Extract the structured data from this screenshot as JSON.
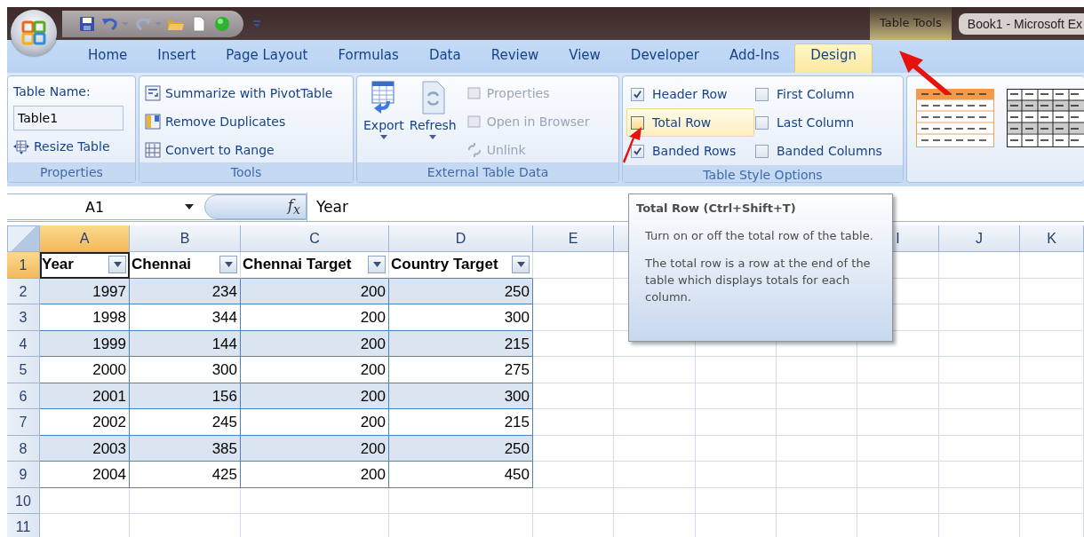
{
  "titlebar": {
    "context_label": "Table Tools",
    "window_title": "Book1  -  Microsoft Ex"
  },
  "tabs": [
    {
      "label": "Home",
      "selected": false
    },
    {
      "label": "Insert",
      "selected": false
    },
    {
      "label": "Page Layout",
      "selected": false
    },
    {
      "label": "Formulas",
      "selected": false
    },
    {
      "label": "Data",
      "selected": false
    },
    {
      "label": "Review",
      "selected": false
    },
    {
      "label": "View",
      "selected": false
    },
    {
      "label": "Developer",
      "selected": false
    },
    {
      "label": "Add-Ins",
      "selected": false
    },
    {
      "label": "Design",
      "selected": true
    }
  ],
  "ribbon": {
    "properties": {
      "label": "Properties",
      "name_label": "Table Name:",
      "name_value": "Table1",
      "resize": "Resize Table"
    },
    "tools": {
      "label": "Tools",
      "commands": [
        "Summarize with PivotTable",
        "Remove Duplicates",
        "Convert to Range"
      ]
    },
    "external": {
      "label": "External Table Data",
      "large": [
        "Export",
        "Refresh"
      ],
      "small": [
        {
          "label": "Properties",
          "disabled": true
        },
        {
          "label": "Open in Browser",
          "disabled": true
        },
        {
          "label": "Unlink",
          "disabled": true
        }
      ]
    },
    "style_options": {
      "label": "Table Style Options",
      "options": [
        {
          "label": "Header Row",
          "checked": true,
          "highlighted": false
        },
        {
          "label": "Total Row",
          "checked": false,
          "highlighted": true
        },
        {
          "label": "Banded Rows",
          "checked": true,
          "highlighted": false
        },
        {
          "label": "First Column",
          "checked": false,
          "highlighted": false
        },
        {
          "label": "Last Column",
          "checked": false,
          "highlighted": false
        },
        {
          "label": "Banded Columns",
          "checked": false,
          "highlighted": false
        }
      ]
    }
  },
  "formula_bar": {
    "name_box": "A1",
    "function_symbol": "f$_{x}$",
    "formula": "Year"
  },
  "sheet": {
    "left_columns": [
      {
        "label": "A",
        "selected": true
      },
      {
        "label": "B",
        "selected": false
      },
      {
        "label": "C",
        "selected": false
      },
      {
        "label": "D",
        "selected": false
      },
      {
        "label": "E",
        "selected": false
      }
    ],
    "right_columns": [
      {
        "label": "I",
        "selected": false
      },
      {
        "label": "J",
        "selected": false
      },
      {
        "label": "K",
        "selected": false
      }
    ],
    "row_headers": [
      {
        "label": "1",
        "selected": true
      },
      {
        "label": "2",
        "selected": false
      },
      {
        "label": "3",
        "selected": false
      },
      {
        "label": "4",
        "selected": false
      },
      {
        "label": "5",
        "selected": false
      },
      {
        "label": "6",
        "selected": false
      },
      {
        "label": "7",
        "selected": false
      },
      {
        "label": "8",
        "selected": false
      },
      {
        "label": "9",
        "selected": false
      },
      {
        "label": "10",
        "selected": false
      },
      {
        "label": "11",
        "selected": false
      }
    ],
    "table_header": [
      {
        "text": "Year",
        "selected": true
      },
      {
        "text": "Chennai",
        "selected": false
      },
      {
        "text": "Chennai Target",
        "selected": false
      },
      {
        "text": "Country Target",
        "selected": false
      }
    ],
    "rows": [
      [
        "1997",
        "234",
        "200",
        "250"
      ],
      [
        "1998",
        "344",
        "200",
        "300"
      ],
      [
        "1999",
        "144",
        "200",
        "215"
      ],
      [
        "2000",
        "300",
        "200",
        "275"
      ],
      [
        "2001",
        "156",
        "200",
        "300"
      ],
      [
        "2002",
        "245",
        "200",
        "215"
      ],
      [
        "2003",
        "385",
        "200",
        "250"
      ],
      [
        "2004",
        "425",
        "200",
        "450"
      ]
    ]
  },
  "tooltip": {
    "title": "Total Row (Ctrl+Shift+T)",
    "paragraphs": [
      "Turn on or off the total row of the table.",
      "The total row is a row at the end of the table which displays totals for each column."
    ]
  }
}
